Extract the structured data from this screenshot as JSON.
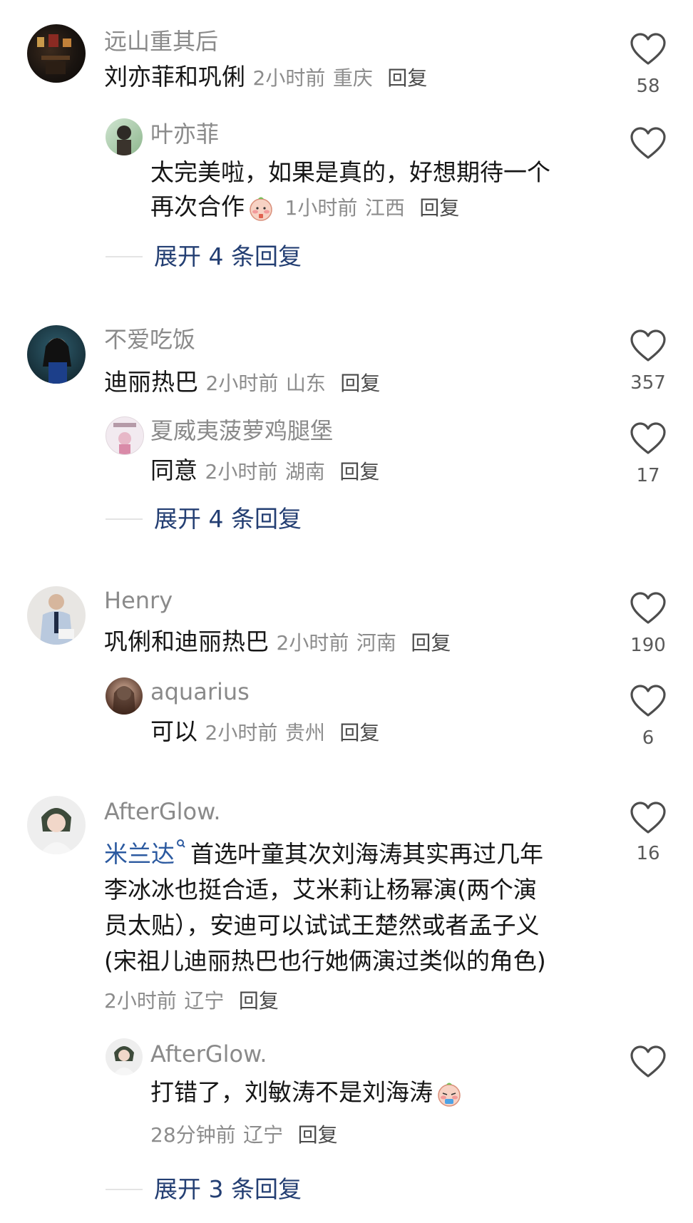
{
  "comments": [
    {
      "user": "远山重其后",
      "text": "刘亦菲和巩俐",
      "time": "2小时前",
      "location": "重庆",
      "reply_label": "回复",
      "likes": "58",
      "replies": [
        {
          "user": "叶亦菲",
          "text_line1": "太完美啦，如果是真的，好想期待一个",
          "text_line2": "再次合作",
          "time": "1小时前",
          "location": "江西",
          "reply_label": "回复",
          "likes": ""
        }
      ],
      "expand": "展开 4 条回复"
    },
    {
      "user": "不爱吃饭",
      "text": "迪丽热巴",
      "time": "2小时前",
      "location": "山东",
      "reply_label": "回复",
      "likes": "357",
      "replies": [
        {
          "user": "夏威夷菠萝鸡腿堡",
          "text": "同意",
          "time": "2小时前",
          "location": "湖南",
          "reply_label": "回复",
          "likes": "17"
        }
      ],
      "expand": "展开 4 条回复"
    },
    {
      "user": "Henry",
      "text": "巩俐和迪丽热巴",
      "time": "2小时前",
      "location": "河南",
      "reply_label": "回复",
      "likes": "190",
      "replies": [
        {
          "user": "aquarius",
          "text": "可以",
          "time": "2小时前",
          "location": "贵州",
          "reply_label": "回复",
          "likes": "6"
        }
      ]
    },
    {
      "user": "AfterGlow.",
      "mention": "米兰达",
      "text_line1": "首选叶童其次刘海涛其实再过几年",
      "text_line2": "李冰冰也挺合适，艾米莉让杨幂演(两个演",
      "text_line3": "员太贴），安迪可以试试王楚然或者孟子义",
      "text_line4": "(宋祖儿迪丽热巴也行她俩演过类似的角色)",
      "time": "2小时前",
      "location": "辽宁",
      "reply_label": "回复",
      "likes": "16",
      "replies": [
        {
          "user": "AfterGlow.",
          "text": "打错了，刘敏涛不是刘海涛",
          "time": "28分钟前",
          "location": "辽宁",
          "reply_label": "回复",
          "likes": ""
        }
      ],
      "expand": "展开 3 条回复"
    }
  ],
  "icons": {
    "like": "heart-outline-icon",
    "emoji": "blushing-face-emoji-icon",
    "mention_suffix": "search-mark-icon"
  },
  "colors": {
    "name": "#8a8a8a",
    "text": "#161616",
    "expand": "#243f73",
    "mention": "#2c5aa0"
  }
}
